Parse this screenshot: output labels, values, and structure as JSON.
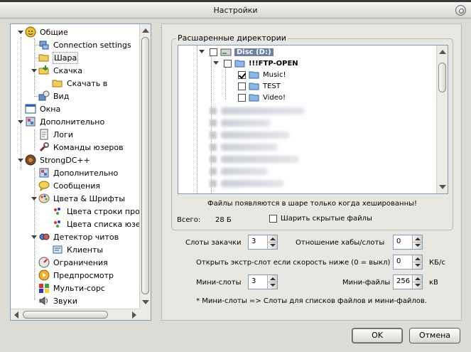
{
  "window": {
    "title": "Настройки"
  },
  "tree": {
    "items": [
      {
        "label": "Общие",
        "icon": "smiley-icon"
      },
      {
        "label": "Connection settings",
        "icon": "network-icon"
      },
      {
        "label": "Шара",
        "icon": "folder-open-icon"
      },
      {
        "label": "Скачка",
        "icon": "download-folder-icon"
      },
      {
        "label": "Скачать в",
        "icon": "folder-icon"
      },
      {
        "label": "Вид",
        "icon": "view-icon"
      },
      {
        "label": "Окна",
        "icon": "window-icon"
      },
      {
        "label": "Дополнительно",
        "icon": "advanced-icon"
      },
      {
        "label": "Логи",
        "icon": "log-icon"
      },
      {
        "label": "Команды юзеров",
        "icon": "wrench-icon"
      },
      {
        "label": "StrongDC++",
        "icon": "strongdc-icon"
      },
      {
        "label": "Дополнительно",
        "icon": "advanced-icon"
      },
      {
        "label": "Сообщения",
        "icon": "message-icon"
      },
      {
        "label": "Цвета & Шрифты",
        "icon": "palette-icon"
      },
      {
        "label": "Цвета строки прогресса",
        "icon": "color-icon"
      },
      {
        "label": "Цвета списка юзеров",
        "icon": "color-icon"
      },
      {
        "label": "Детектор читов",
        "icon": "detector-icon"
      },
      {
        "label": "Клиенты",
        "icon": "clients-icon"
      },
      {
        "label": "Ограничения",
        "icon": "limits-icon"
      },
      {
        "label": "Предпросмотр",
        "icon": "preview-icon"
      },
      {
        "label": "Мульти-сорс",
        "icon": "multisource-icon"
      },
      {
        "label": "Звуки",
        "icon": "sound-icon"
      }
    ]
  },
  "share": {
    "group_title": "Расшаренные директории",
    "dirs": [
      {
        "label": "Disc (D:)",
        "checked": false
      },
      {
        "label": "!!!FTP-OPEN",
        "checked": false
      },
      {
        "label": "Music!",
        "checked": true
      },
      {
        "label": "TEST",
        "checked": false
      },
      {
        "label": "Video!",
        "checked": false
      }
    ],
    "hint": "Файлы появляются в шаре только когда хешированны!",
    "total_label": "Всего:",
    "total_value": "28 Б",
    "share_hidden_label": "Шарить скрытые файлы"
  },
  "settings": {
    "download_slots_label": "Слоты закачки",
    "download_slots_value": "3",
    "hub_slots_ratio_label": "Отношение хабы/слоты",
    "hub_slots_ratio_value": "0",
    "extra_slot_label": "Открыть экстр-слот если скорость ниже (0 = выкл)",
    "extra_slot_value": "0",
    "extra_slot_unit": "КБ/с",
    "mini_slots_label": "Мини-слоты",
    "mini_slots_value": "3",
    "mini_files_label": "Мини-файлы",
    "mini_files_value": "256",
    "mini_files_unit": "кВ",
    "note": "* Мини-слоты => Слоты для списков файлов и мини-файлов."
  },
  "buttons": {
    "ok": "OK",
    "cancel": "Отмена"
  }
}
